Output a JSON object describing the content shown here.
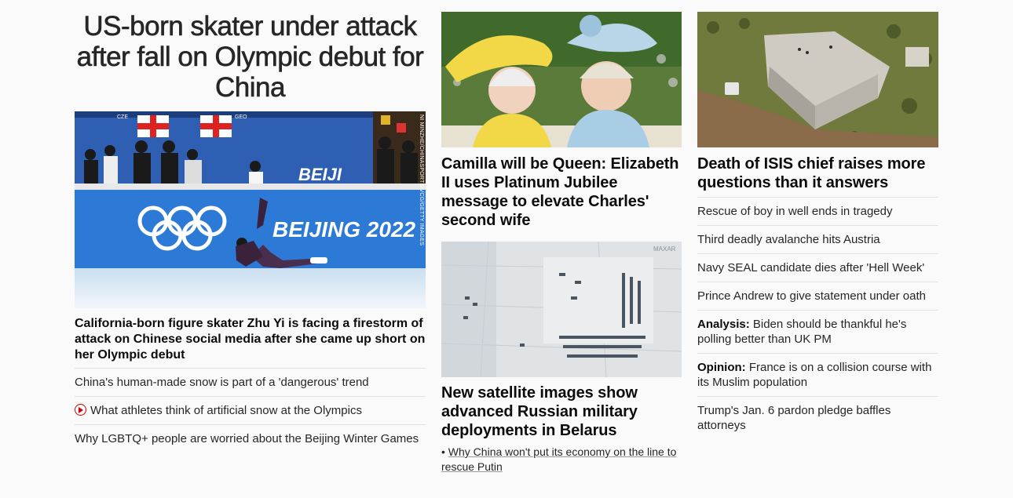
{
  "col1": {
    "headline": "US-born skater under attack after fall on Olympic debut for China",
    "image_credit": "NI MINZHE/CHINASPORTS/VCG/GETTY IMAGES",
    "image_banner_text": "BEIJING 2022",
    "image_board_text": "BEIJI",
    "image_flag_labels": [
      "CZE",
      "GEO"
    ],
    "summary": "California-born figure skater Zhu Yi is facing a firestorm of attack on Chinese social media after she came up short on her Olympic debut",
    "links": [
      {
        "text": "China's human-made snow is part of a 'dangerous' trend"
      },
      {
        "text": "What athletes think of artificial snow at the Olympics",
        "icon": "play-icon"
      },
      {
        "text": "Why LGBTQ+ people are worried about the Beijing Winter Games"
      }
    ]
  },
  "col2": {
    "story1": {
      "headline": "Camilla will be Queen: Elizabeth II uses Platinum Jubilee message to elevate Charles' second wife"
    },
    "story2": {
      "image_watermark": "MAXAR",
      "headline": "New satellite images show advanced Russian military deployments in Belarus",
      "related_bullet": "•",
      "related": "Why China won't put its economy on the line to rescue Putin"
    }
  },
  "col3": {
    "headline": "Death of ISIS chief raises more questions than it answers",
    "links": [
      {
        "text": "Rescue of boy in well ends in tragedy"
      },
      {
        "text": "Third deadly avalanche hits Austria"
      },
      {
        "text": "Navy SEAL candidate dies after 'Hell Week'"
      },
      {
        "text": "Prince Andrew to give statement under oath"
      },
      {
        "prefix": "Analysis:",
        "text": "Biden should be thankful he's polling better than UK PM"
      },
      {
        "prefix": "Opinion:",
        "text": "France is on a collision course with its Muslim population"
      },
      {
        "text": "Trump's Jan. 6 pardon pledge baffles attorneys"
      }
    ]
  },
  "colors": {
    "accent_red": "#cc0000",
    "text": "#0c0c0c",
    "divider": "#e2e2e2"
  }
}
